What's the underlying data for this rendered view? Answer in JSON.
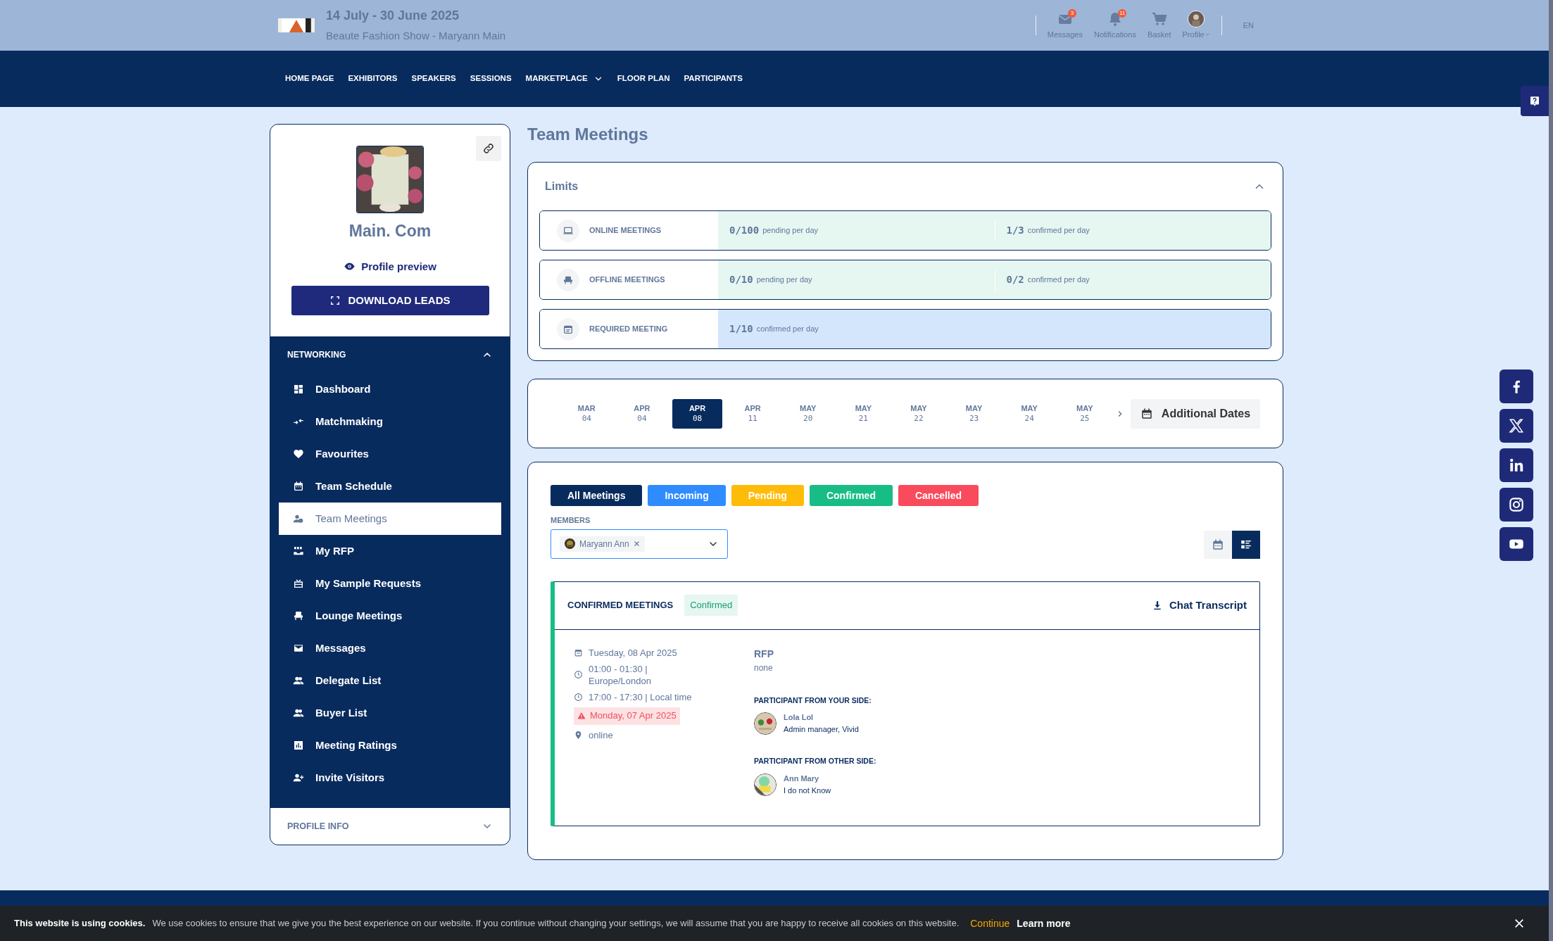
{
  "header": {
    "date_range": "14 July - 30 June 2025",
    "event_name": "Beaute Fashion Show - Maryann Main",
    "actions": [
      {
        "kind": "messages",
        "label": "Messages",
        "badge": "3"
      },
      {
        "kind": "notifications",
        "label": "Notifications",
        "badge": "11"
      },
      {
        "kind": "basket",
        "label": "Basket"
      },
      {
        "kind": "profile",
        "label": "Profile"
      }
    ],
    "language": "EN"
  },
  "nav": {
    "items": [
      {
        "label": "HOME PAGE",
        "dropdown": false
      },
      {
        "label": "EXHIBITORS",
        "dropdown": false
      },
      {
        "label": "SPEAKERS",
        "dropdown": false
      },
      {
        "label": "SESSIONS",
        "dropdown": false
      },
      {
        "label": "MARKETPLACE",
        "dropdown": true
      },
      {
        "label": "FLOOR PLAN",
        "dropdown": false
      },
      {
        "label": "PARTICIPANTS",
        "dropdown": false
      }
    ]
  },
  "profile": {
    "name": "Main. Com",
    "preview_link": "Profile preview",
    "download_button": "DOWNLOAD LEADS"
  },
  "sidebar": {
    "section": {
      "title": "NETWORKING",
      "expanded": true
    },
    "items": [
      {
        "label": "Dashboard",
        "selected": false
      },
      {
        "label": "Matchmaking",
        "selected": false
      },
      {
        "label": "Favourites",
        "selected": false
      },
      {
        "label": "Team Schedule",
        "selected": false
      },
      {
        "label": "Team Meetings",
        "selected": true
      },
      {
        "label": "My RFP",
        "selected": false
      },
      {
        "label": "My Sample Requests",
        "selected": false
      },
      {
        "label": "Lounge Meetings",
        "selected": false
      },
      {
        "label": "Messages",
        "selected": false
      },
      {
        "label": "Delegate List",
        "selected": false
      },
      {
        "label": "Buyer List",
        "selected": false
      },
      {
        "label": "Meeting Ratings",
        "selected": false
      },
      {
        "label": "Invite Visitors",
        "selected": false
      }
    ],
    "profile_info": {
      "title": "PROFILE INFO",
      "expanded": false
    }
  },
  "page_title": "Team Meetings",
  "limits": {
    "title": "Limits",
    "expanded": true,
    "rows": [
      {
        "kind": "online",
        "label": "ONLINE MEETINGS",
        "color": "#e6f6f1",
        "cells": [
          {
            "value": "0/100",
            "caption": "pending per day"
          },
          {
            "value": "1/3",
            "caption": "confirmed per day"
          }
        ]
      },
      {
        "kind": "offline",
        "label": "OFFLINE MEETINGS",
        "color": "#e6f6f1",
        "cells": [
          {
            "value": "0/10",
            "caption": "pending per day"
          },
          {
            "value": "0/2",
            "caption": "confirmed per day"
          }
        ]
      },
      {
        "kind": "required",
        "label": "REQUIRED MEETING",
        "color": "#d4e6fc",
        "cells": [
          {
            "value": "1/10",
            "caption": "confirmed per day"
          }
        ]
      }
    ]
  },
  "dates": {
    "items": [
      {
        "month": "MAR",
        "day": "04",
        "selected": false
      },
      {
        "month": "APR",
        "day": "04",
        "selected": false
      },
      {
        "month": "APR",
        "day": "08",
        "selected": true
      },
      {
        "month": "APR",
        "day": "11",
        "selected": false
      },
      {
        "month": "MAY",
        "day": "20",
        "selected": false
      },
      {
        "month": "MAY",
        "day": "21",
        "selected": false
      },
      {
        "month": "MAY",
        "day": "22",
        "selected": false
      },
      {
        "month": "MAY",
        "day": "23",
        "selected": false
      },
      {
        "month": "MAY",
        "day": "24",
        "selected": false
      },
      {
        "month": "MAY",
        "day": "25",
        "selected": false
      }
    ],
    "additional": "Additional Dates"
  },
  "filters": [
    {
      "label": "All Meetings",
      "color": "#082b5e"
    },
    {
      "label": "Incoming",
      "color": "#2f8cff"
    },
    {
      "label": "Pending",
      "color": "#ffbb0a"
    },
    {
      "label": "Confirmed",
      "color": "#18bd85"
    },
    {
      "label": "Cancelled",
      "color": "#fa4b5c"
    }
  ],
  "members": {
    "label": "MEMBERS",
    "chips": [
      {
        "name": "Maryann Ann"
      }
    ]
  },
  "views": [
    {
      "kind": "calendar",
      "selected": false
    },
    {
      "kind": "list",
      "selected": true
    }
  ],
  "meeting": {
    "title": "CONFIRMED MEETINGS",
    "status": "Confirmed",
    "chat_transcript": "Chat Transcript",
    "date": "Tuesday, 08 Apr 2025",
    "time": "01:00 - 01:30 | Europe/London",
    "local_time": "17:00 - 17:30 | Local time",
    "warning_date": "Monday, 07 Apr 2025",
    "location": "online",
    "rfp_label": "RFP",
    "rfp_value": "none",
    "groups": [
      {
        "title": "PARTICIPANT FROM YOUR SIDE:",
        "people": [
          {
            "name": "Lola Lol",
            "role": "Admin manager, Vivid"
          }
        ]
      },
      {
        "title": "PARTICIPANT FROM OTHER SIDE:",
        "people": [
          {
            "name": "Ann Mary",
            "role": "I do not Know"
          }
        ]
      }
    ]
  },
  "cookie": {
    "title": "This website is using cookies.",
    "text": "We use cookies to ensure that we give you the best experience on our website. If you continue without changing your settings, we will assume that you are happy to receive all cookies on this website.",
    "continue": "Continue",
    "learn_more": "Learn more"
  }
}
